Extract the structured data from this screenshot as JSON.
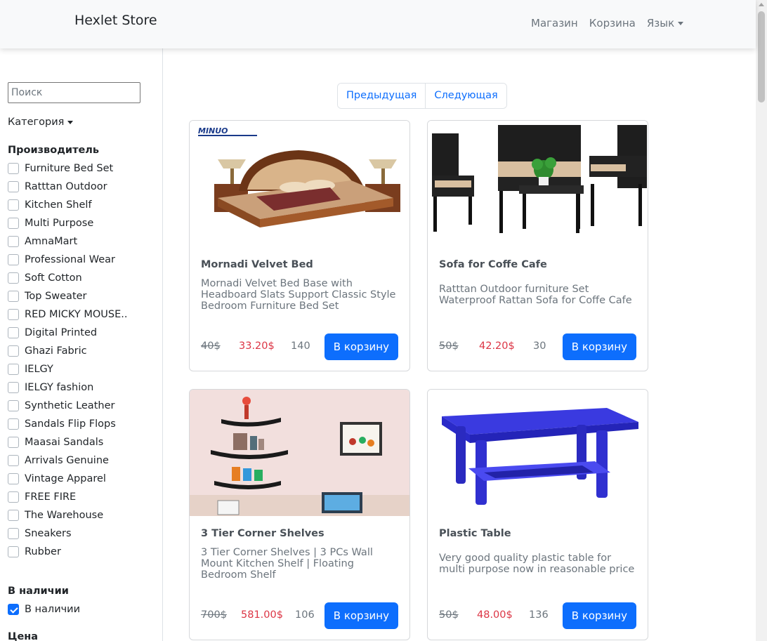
{
  "navbar": {
    "brand": "Hexlet Store",
    "links": [
      "Магазин",
      "Корзина"
    ],
    "language": "Язык"
  },
  "sidebar": {
    "search_placeholder": "Поиск",
    "category_label": "Категория",
    "manufacturer_title": "Производитель",
    "manufacturers": [
      "Furniture Bed Set",
      "Ratttan Outdoor",
      "Kitchen Shelf",
      "Multi Purpose",
      "AmnaMart",
      "Professional Wear",
      "Soft Cotton",
      "Top Sweater",
      "RED MICKY MOUSE..",
      "Digital Printed",
      "Ghazi Fabric",
      "IELGY",
      "IELGY fashion",
      "Synthetic Leather",
      "Sandals Flip Flops",
      "Maasai Sandals",
      "Arrivals Genuine",
      "Vintage Apparel",
      "FREE FIRE",
      "The Warehouse",
      "Sneakers",
      "Rubber"
    ],
    "stock_title": "В наличии",
    "stock_label": "В наличии",
    "stock_checked": true,
    "price_title": "Цена"
  },
  "pagination": {
    "prev": "Предыдущая",
    "next": "Следующая"
  },
  "products": [
    {
      "title": "Mornadi Velvet Bed",
      "description": "Mornadi Velvet Bed Base with Headboard Slats Support Classic Style Bedroom Furniture Bed Set",
      "old_price": "40$",
      "new_price": "33.20$",
      "stock": "140",
      "button": "В корзину",
      "image_logo": "MINUO"
    },
    {
      "title": "Sofa for Coffe Cafe",
      "description": "Ratttan Outdoor furniture Set Waterproof Rattan Sofa for Coffe Cafe",
      "old_price": "50$",
      "new_price": "42.20$",
      "stock": "30",
      "button": "В корзину"
    },
    {
      "title": "3 Tier Corner Shelves",
      "description": "3 Tier Corner Shelves | 3 PCs Wall Mount Kitchen Shelf | Floating Bedroom Shelf",
      "old_price": "700$",
      "new_price": "581.00$",
      "stock": "106",
      "button": "В корзину"
    },
    {
      "title": "Plastic Table",
      "description": "Very good quality plastic table for multi purpose now in reasonable price",
      "old_price": "50$",
      "new_price": "48.00$",
      "stock": "136",
      "button": "В корзину"
    }
  ],
  "colors": {
    "primary": "#0d6efd",
    "sale": "#dc3545",
    "muted": "#6c757d"
  }
}
